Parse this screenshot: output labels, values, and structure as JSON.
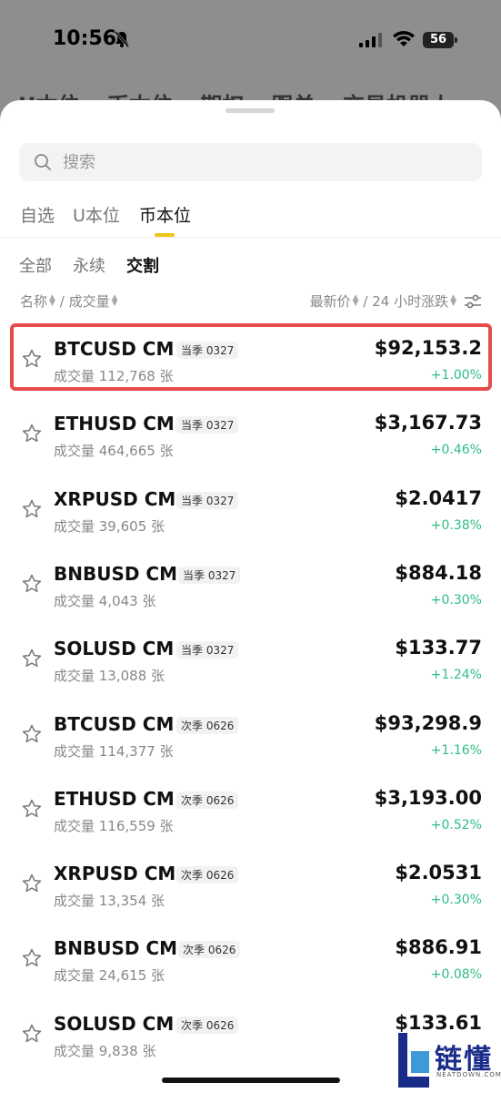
{
  "status_bar": {
    "time": "10:56",
    "battery": "56"
  },
  "background_tabs": [
    "U本位",
    "币本位",
    "期权",
    "跟单",
    "交易机器人"
  ],
  "search": {
    "placeholder": "搜索"
  },
  "tabs": [
    "自选",
    "U本位",
    "币本位"
  ],
  "active_tab": "币本位",
  "subtabs": [
    "全部",
    "永续",
    "交割"
  ],
  "active_subtab": "交割",
  "sort": {
    "name": "名称",
    "slash1": "/",
    "volume": "成交量",
    "last": "最新价",
    "slash2": "/",
    "change": "24 小时涨跌"
  },
  "rows": [
    {
      "symbol": "BTCUSD CM",
      "tag": "当季 0327",
      "volume": "成交量 112,768 张",
      "price": "$92,153.2",
      "change": "+1.00%",
      "highlighted": true
    },
    {
      "symbol": "ETHUSD CM",
      "tag": "当季 0327",
      "volume": "成交量 464,665 张",
      "price": "$3,167.73",
      "change": "+0.46%"
    },
    {
      "symbol": "XRPUSD CM",
      "tag": "当季 0327",
      "volume": "成交量 39,605 张",
      "price": "$2.0417",
      "change": "+0.38%"
    },
    {
      "symbol": "BNBUSD CM",
      "tag": "当季 0327",
      "volume": "成交量 4,043 张",
      "price": "$884.18",
      "change": "+0.30%"
    },
    {
      "symbol": "SOLUSD CM",
      "tag": "当季 0327",
      "volume": "成交量 13,088 张",
      "price": "$133.77",
      "change": "+1.24%"
    },
    {
      "symbol": "BTCUSD CM",
      "tag": "次季 0626",
      "volume": "成交量 114,377 张",
      "price": "$93,298.9",
      "change": "+1.16%"
    },
    {
      "symbol": "ETHUSD CM",
      "tag": "次季 0626",
      "volume": "成交量 116,559 张",
      "price": "$3,193.00",
      "change": "+0.52%"
    },
    {
      "symbol": "XRPUSD CM",
      "tag": "次季 0626",
      "volume": "成交量 13,354 张",
      "price": "$2.0531",
      "change": "+0.30%"
    },
    {
      "symbol": "BNBUSD CM",
      "tag": "次季 0626",
      "volume": "成交量 24,615 张",
      "price": "$886.91",
      "change": "+0.08%"
    },
    {
      "symbol": "SOLUSD CM",
      "tag": "次季 0626",
      "volume": "成交量 9,838 张",
      "price": "$133.61",
      "change": ""
    }
  ],
  "watermark": {
    "text": "链懂",
    "sub": "NEATDOWN.COM"
  },
  "colors": {
    "accent": "#f0c417",
    "positive": "#2ebd85",
    "highlight": "#e84b4b"
  },
  "icons": {
    "search": "search-icon",
    "star": "star-icon",
    "settings": "filter-settings-icon"
  }
}
